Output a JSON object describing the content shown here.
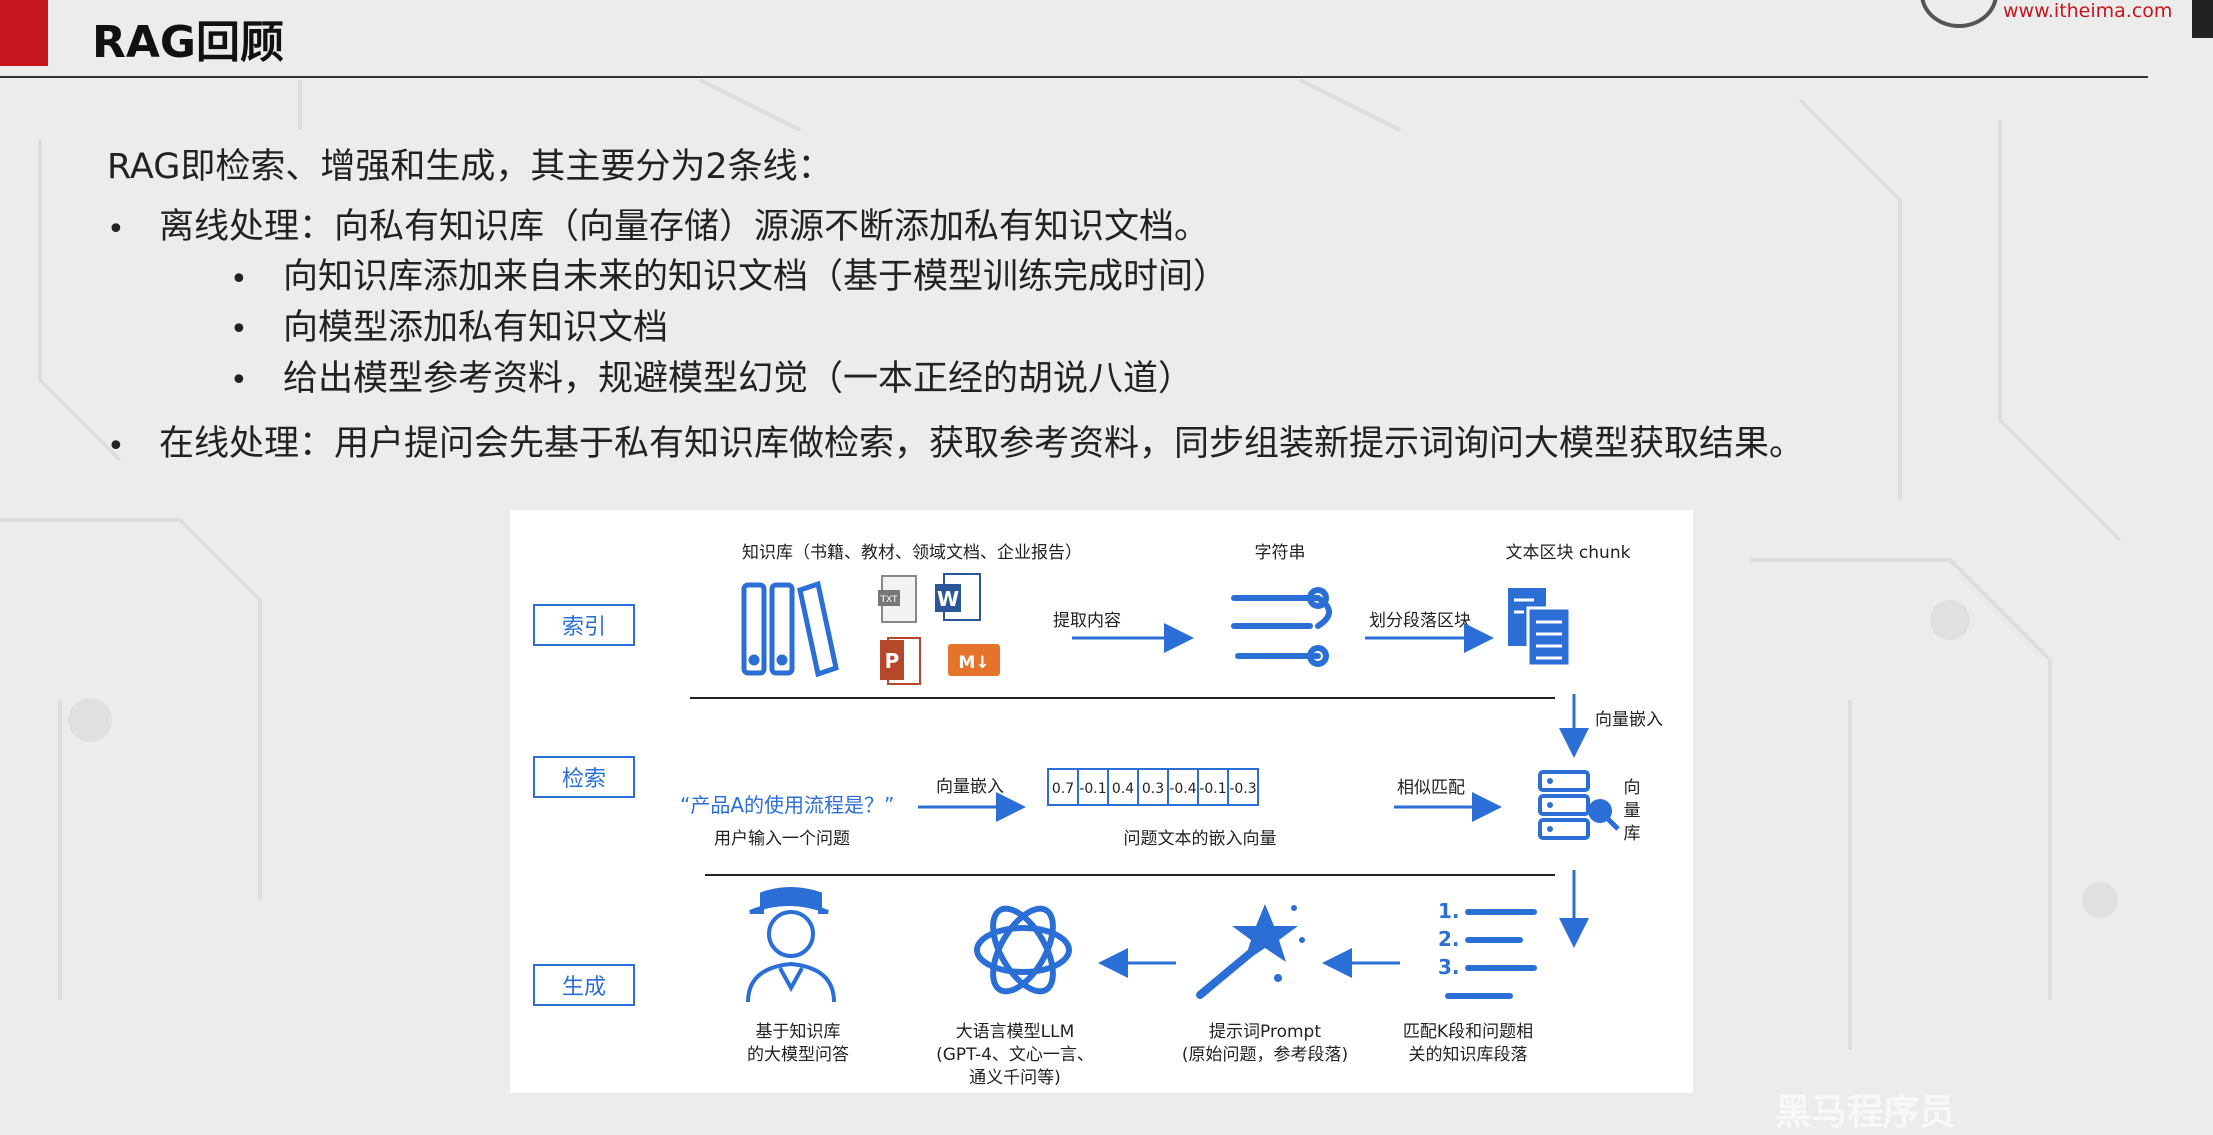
{
  "header": {
    "title": "RAG回顾",
    "brand_url": "www.itheima.com",
    "accent_color": "#c4161c"
  },
  "content": {
    "intro": "RAG即检索、增强和生成，其主要分为2条线：",
    "offline": "离线处理：向私有知识库（向量存储）源源不断添加私有知识文档。",
    "offline_items": [
      "向知识库添加来自未来的知识文档（基于模型训练完成时间）",
      "向模型添加私有知识文档",
      "给出模型参考资料，规避模型幻觉（一本正经的胡说八道）"
    ],
    "online": "在线处理：用户提问会先基于私有知识库做检索，获取参考资料，同步组装新提示词询问大模型获取结果。"
  },
  "diagram": {
    "accent_color": "#2b6fd6",
    "stages": [
      "索引",
      "检索",
      "生成"
    ],
    "kb_label": "知识库（书籍、教材、领域文档、企业报告）",
    "extract_label": "提取内容",
    "string_label": "字符串",
    "split_label": "划分段落区块",
    "chunk_label": "文本区块 chunk",
    "embed_label_right": "向量嵌入",
    "question": "“产品A的使用流程是？”",
    "question_caption": "用户输入一个问题",
    "embed_label_mid": "向量嵌入",
    "vector_values": [
      "0.7",
      "-0.1",
      "0.4",
      "0.3",
      "-0.4",
      "-0.1",
      "-0.3"
    ],
    "vector_caption": "问题文本的嵌入向量",
    "similar_label": "相似匹配",
    "vector_db_label": [
      "向",
      "量",
      "库"
    ],
    "list_numbers": [
      "1.",
      "2.",
      "3."
    ],
    "answer_caption": [
      "基于知识库",
      "的大模型问答"
    ],
    "llm_caption": [
      "大语言模型LLM",
      "(GPT-4、文心一言、",
      "通义千问等)"
    ],
    "prompt_caption": [
      "提示词Prompt",
      "(原始问题，参考段落)"
    ],
    "topk_caption": [
      "匹配K段和问题相",
      "关的知识库段落"
    ],
    "file_badges": [
      "TXT",
      "W",
      "P",
      "M↓"
    ]
  },
  "watermark": "黑马程序员"
}
